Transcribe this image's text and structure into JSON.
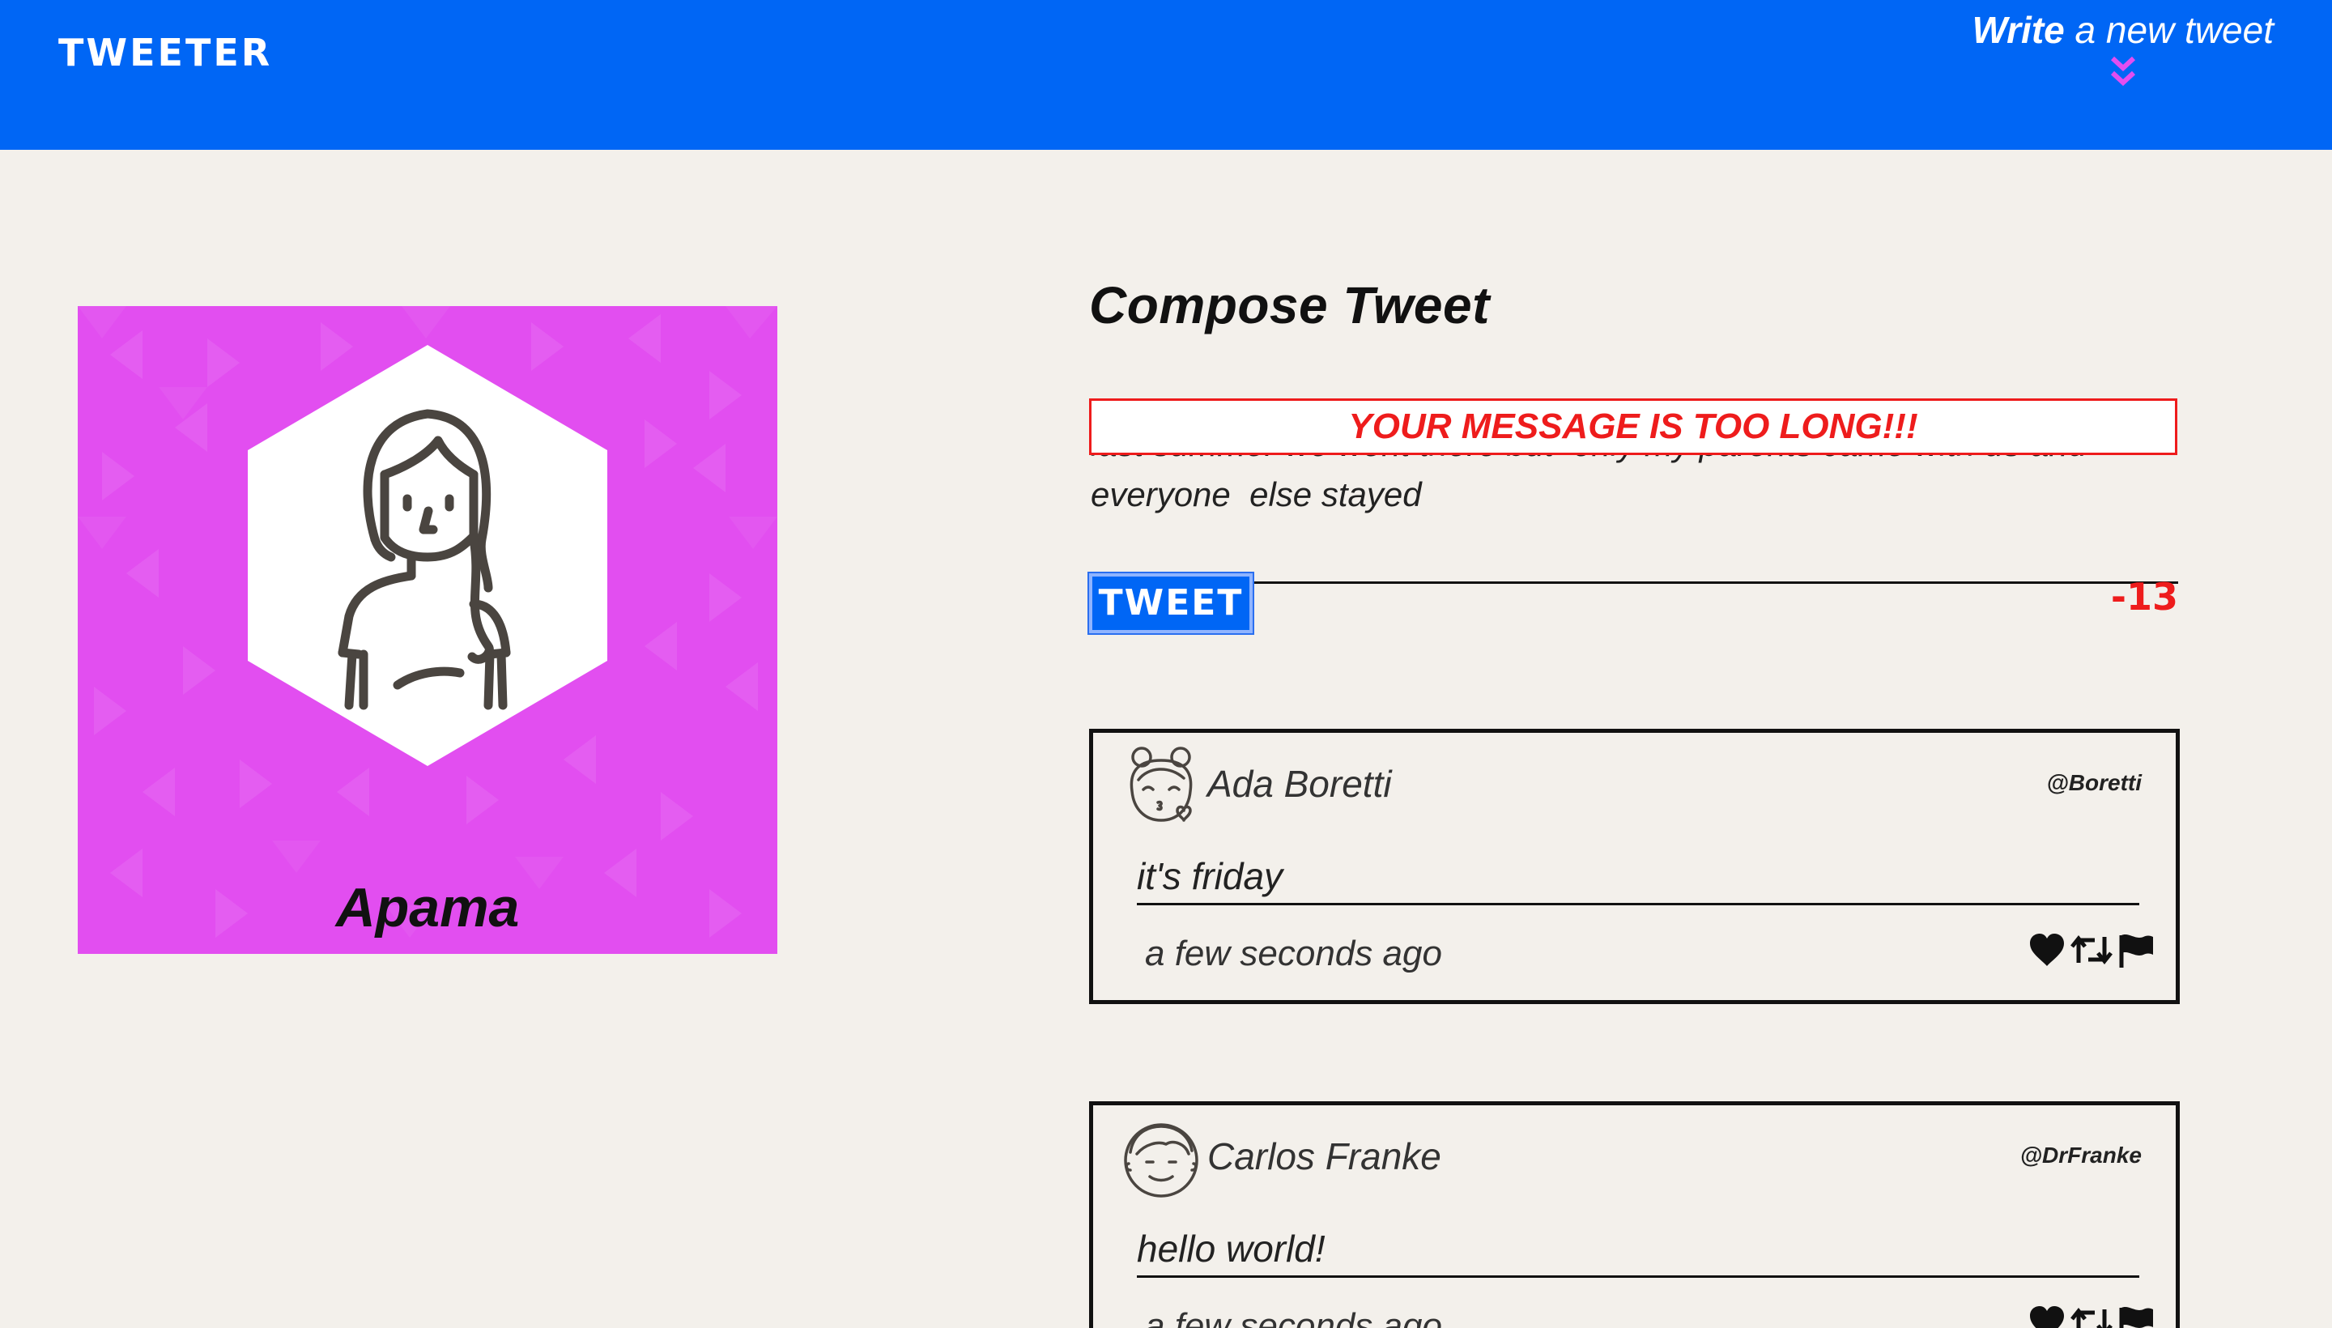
{
  "nav": {
    "brand": "TWEETER",
    "write_bold": "Write",
    "write_rest": " a new tweet",
    "chevron_icon": "double-chevron-down-icon",
    "bg_color": "#0066f5",
    "chevron_color": "#e24ef0"
  },
  "profile": {
    "name": "Apama",
    "avatar_icon": "woman-avatar-icon",
    "bg_color": "#e24ef0"
  },
  "compose": {
    "title": "Compose Tweet",
    "error": "YOUR MESSAGE IS TOO LONG!!!",
    "input_value": "last summer we went there but  only my parents came with us and everyone  else stayed",
    "button_label": "TWEET",
    "counter": "-13",
    "error_color": "#ee1c1c"
  },
  "tweets": [
    {
      "author": "Ada Boretti",
      "handle": "@Boretti",
      "avatar_icon": "girl-kiss-avatar-icon",
      "content": "it's friday",
      "timestamp": "a few seconds ago",
      "action_icons": [
        "heart-icon",
        "retweet-icon",
        "flag-icon"
      ]
    },
    {
      "author": "Carlos Franke",
      "handle": "@DrFranke",
      "avatar_icon": "boy-avatar-icon",
      "content": "hello world!",
      "timestamp": "a few seconds ago",
      "action_icons": [
        "heart-icon",
        "retweet-icon",
        "flag-icon"
      ]
    }
  ]
}
